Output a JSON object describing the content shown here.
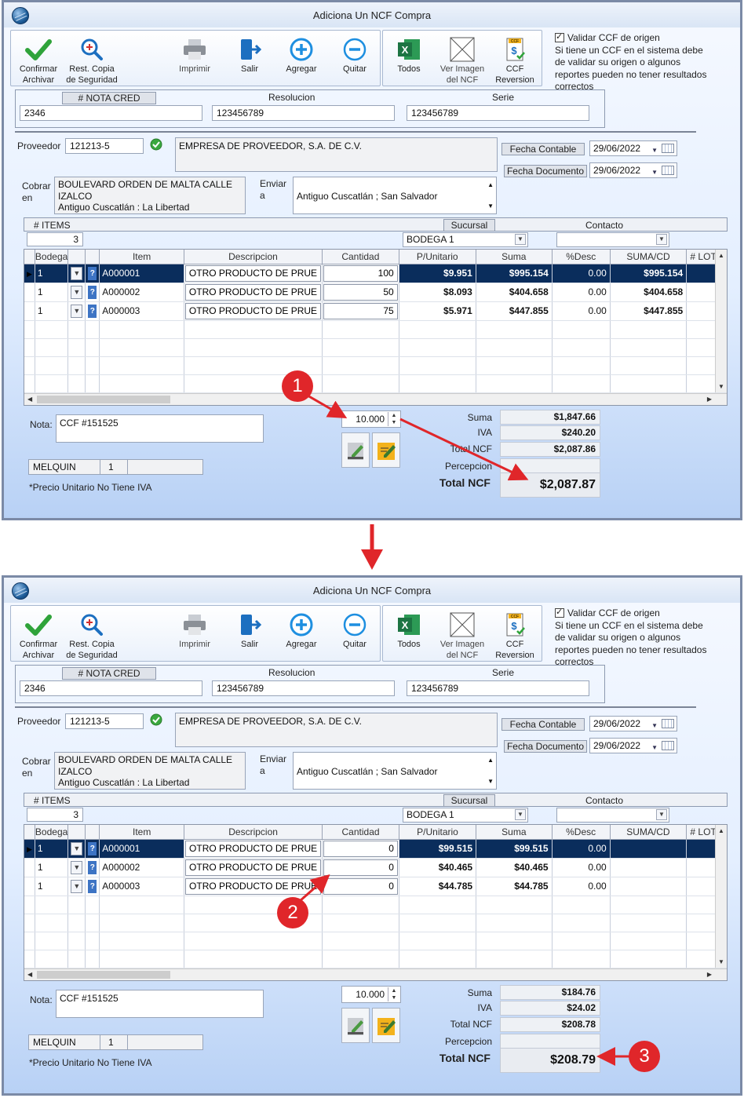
{
  "window_title": "Adiciona Un NCF Compra",
  "toolbar": {
    "confirm_label": "Confirmar\nArchivar",
    "rest_label": "Rest. Copia\nde Seguridad",
    "print_label": "Imprimir",
    "exit_label": "Salir",
    "add_label": "Agregar",
    "remove_label": "Quitar",
    "todos_label": "Todos",
    "ver_imagen_label": "Ver Imagen\ndel NCF",
    "ccf_rev_label": "CCF\nReversion",
    "ccf_badge": "CCF"
  },
  "validar": {
    "label": "Validar CCF de origen",
    "note": "Si tiene un CCF en el sistema debe de validar su origen o algunos reportes pueden no tener resultados correctos"
  },
  "doc": {
    "nota_cred_label": "# NOTA CRED",
    "nota_cred_value": "2346",
    "resolucion_label": "Resolucion",
    "resolucion_value": "123456789",
    "serie_label": "Serie",
    "serie_value": "123456789"
  },
  "proveedor": {
    "label": "Proveedor",
    "code": "121213-5",
    "name": "EMPRESA DE PROVEEDOR, S.A. DE C.V."
  },
  "fechas": {
    "contable_label": "Fecha Contable",
    "contable_value": "29/06/2022",
    "documento_label": "Fecha Documento",
    "documento_value": "29/06/2022"
  },
  "cobrar": {
    "label1": "Cobrar",
    "label2": "en",
    "line1": "BOULEVARD ORDEN DE MALTA CALLE",
    "line2": "IZALCO",
    "line3": "Antiguo Cuscatlán : La Libertad"
  },
  "enviar": {
    "label1": "Enviar",
    "label2": "a",
    "value": "Antiguo Cuscatlán ; San Salvador"
  },
  "items_bar": {
    "items_label": "# ITEMS",
    "items_count": "3",
    "sucursal_label": "Sucursal",
    "sucursal_value": "BODEGA 1",
    "contacto_label": "Contacto"
  },
  "columns": [
    "Bodega",
    "Item",
    "Descripcion",
    "Cantidad",
    "P/Unitario",
    "Suma",
    "%Desc",
    "SUMA/CD",
    "# LOTE"
  ],
  "nota": {
    "label": "Nota:",
    "value": "CCF  #151525"
  },
  "user": {
    "name": "MELQUIN",
    "num": "1"
  },
  "precio_note": "*Precio Unitario No Tiene IVA",
  "totals_labels": {
    "suma": "Suma",
    "iva": "IVA",
    "total_ncf": "Total  NCF",
    "percepcion": "Percepcion",
    "total_ncf_big": "Total  NCF"
  },
  "spin_value": "10.000",
  "badges": [
    "1",
    "2",
    "3"
  ],
  "before": {
    "rows": [
      {
        "bodega": "1",
        "item": "A000001",
        "desc": "OTRO PRODUCTO DE PRUE",
        "cantidad": "100",
        "punit": "$9.951",
        "suma": "$995.154",
        "desc_pct": "0.00",
        "sumacd": "$995.154"
      },
      {
        "bodega": "1",
        "item": "A000002",
        "desc": "OTRO PRODUCTO DE PRUE",
        "cantidad": "50",
        "punit": "$8.093",
        "suma": "$404.658",
        "desc_pct": "0.00",
        "sumacd": "$404.658"
      },
      {
        "bodega": "1",
        "item": "A000003",
        "desc": "OTRO PRODUCTO DE PRUE",
        "cantidad": "75",
        "punit": "$5.971",
        "suma": "$447.855",
        "desc_pct": "0.00",
        "sumacd": "$447.855"
      }
    ],
    "totals": {
      "suma": "$1,847.66",
      "iva": "$240.20",
      "total_ncf": "$2,087.86",
      "percepcion": "",
      "total_big": "$2,087.87"
    }
  },
  "after": {
    "rows": [
      {
        "bodega": "1",
        "item": "A000001",
        "desc": "OTRO PRODUCTO DE PRUE",
        "cantidad": "0",
        "punit": "$99.515",
        "suma": "$99.515",
        "desc_pct": "0.00",
        "sumacd": ""
      },
      {
        "bodega": "1",
        "item": "A000002",
        "desc": "OTRO PRODUCTO DE PRUE",
        "cantidad": "0",
        "punit": "$40.465",
        "suma": "$40.465",
        "desc_pct": "0.00",
        "sumacd": ""
      },
      {
        "bodega": "1",
        "item": "A000003",
        "desc": "OTRO PRODUCTO DE PRUE",
        "cantidad": "0",
        "punit": "$44.785",
        "suma": "$44.785",
        "desc_pct": "0.00",
        "sumacd": ""
      }
    ],
    "totals": {
      "suma": "$184.76",
      "iva": "$24.02",
      "total_ncf": "$208.78",
      "percepcion": "",
      "total_big": "$208.79"
    }
  },
  "colors": {
    "arrow": "#e0262a",
    "selected_row": "#0a2d5c"
  }
}
